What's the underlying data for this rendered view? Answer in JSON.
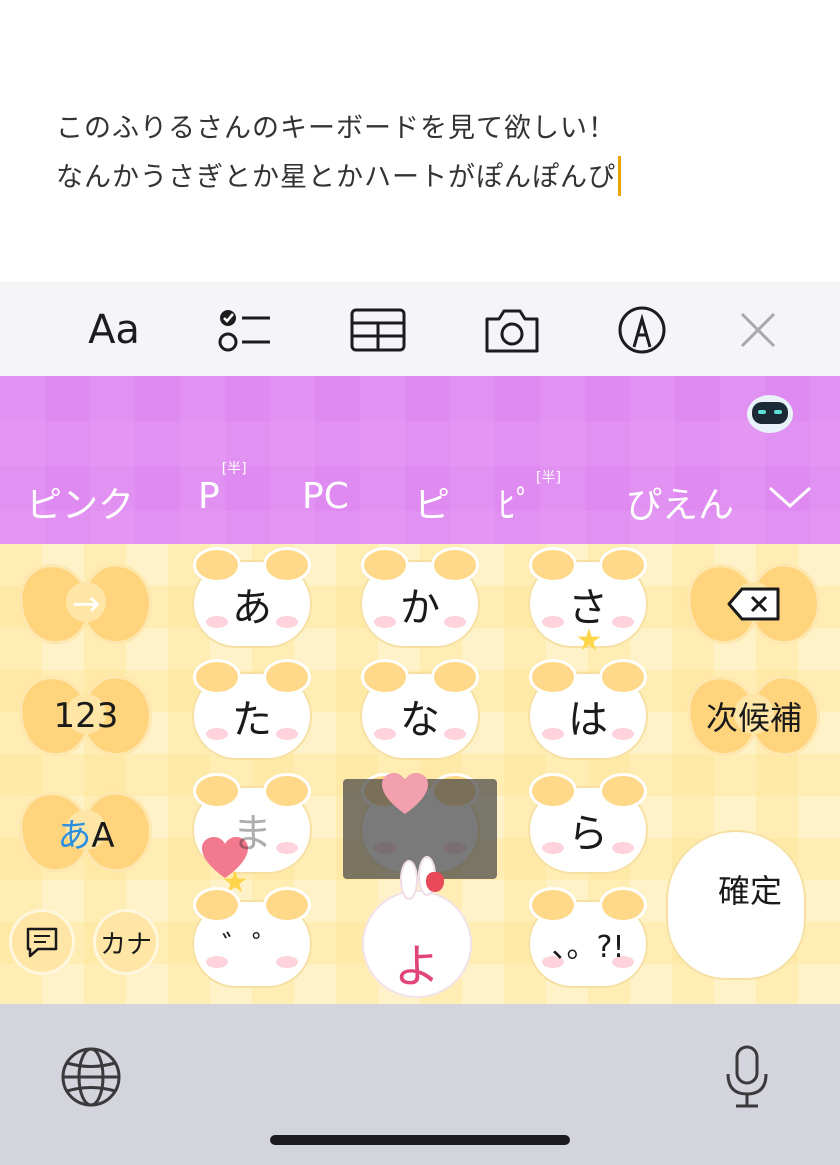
{
  "note": {
    "line1": "このふりるさんのキーボードを見て欲しい！",
    "line2": "なんかうさぎとか星とかハートがぽんぽんぴ"
  },
  "toolbar": {
    "text_format_label": "Aa",
    "icons": [
      "checklist-icon",
      "table-icon",
      "camera-icon",
      "markup-pen-icon",
      "close-icon"
    ]
  },
  "candidates": [
    {
      "label": "ピンク",
      "tag": ""
    },
    {
      "label": "P",
      "tag": "[半]"
    },
    {
      "label": "PC",
      "tag": ""
    },
    {
      "label": "ピ",
      "tag": ""
    },
    {
      "label": "ﾋﾟ",
      "tag": "[半]"
    },
    {
      "label": "ぴえん",
      "tag": ""
    }
  ],
  "keyboard": {
    "row1": {
      "left": "→",
      "k1": "あ",
      "k2": "か",
      "k3": "さ"
    },
    "row2": {
      "left": "123",
      "k1": "た",
      "k2": "な",
      "k3": "は",
      "right": "次候補"
    },
    "row3": {
      "left_a": "あ",
      "left_b": "A",
      "k1": "ま",
      "k3": "ら"
    },
    "row4": {
      "kana": "カナ",
      "k1": "゛゜",
      "k2": "よ",
      "k3": "、。?!"
    },
    "confirm": "確定"
  },
  "colors": {
    "candidate_bar": "#df8af0",
    "keyboard_bg": "#fff2c8",
    "caret": "#e8a400",
    "yo_key_text": "#e0457a",
    "left_key_accent": "#2a8fe0"
  }
}
